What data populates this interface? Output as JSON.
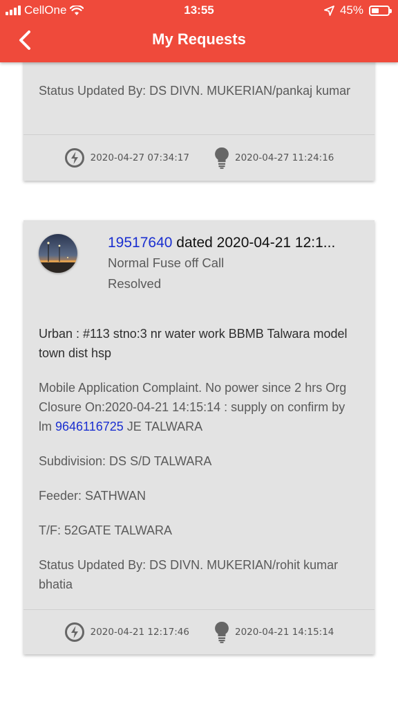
{
  "status_bar": {
    "carrier": "CellOne",
    "time": "13:55",
    "battery": "45%",
    "battery_level": 0.45
  },
  "header": {
    "title": "My Requests",
    "back_icon": "chevron-left-icon"
  },
  "colors": {
    "header_bg": "#ef4a3b",
    "card_bg": "#e3e3e3",
    "link": "#1a2fd0"
  },
  "cards": [
    {
      "status_updated_by": "Status Updated By: DS DIVN. MUKERIAN/pankaj kumar",
      "complaint_time": "2020-04-27 07:34:17",
      "resolved_time": "2020-04-27 11:24:16"
    },
    {
      "request_id": "19517640",
      "dated": " dated 2020-04-21 12:1...",
      "category": "Normal Fuse off Call",
      "status": "Resolved",
      "address": "Urban : #113 stno:3 nr water work BBMB Talwara model town dist hsp",
      "remarks_prefix": "Mobile Application Complaint. No power since 2 hrs Org Closure On:2020-04-21 14:15:14 : supply on confirm by lm ",
      "remarks_phone": "9646116725",
      "remarks_suffix": " JE TALWARA",
      "subdivision": "Subdivision: DS S/D TALWARA",
      "feeder": "Feeder: SATHWAN",
      "transformer": "T/F: 52GATE TALWARA",
      "status_updated_by": "Status Updated By: DS DIVN. MUKERIAN/rohit kumar bhatia",
      "complaint_time": "2020-04-21 12:17:46",
      "resolved_time": "2020-04-21 14:15:14"
    }
  ]
}
